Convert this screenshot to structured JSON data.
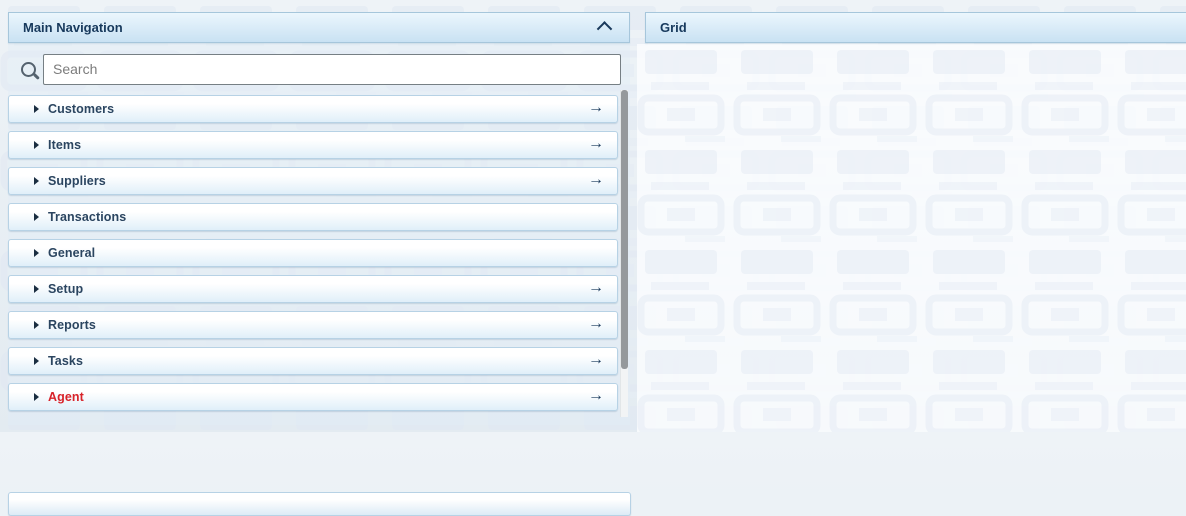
{
  "nav": {
    "title": "Main Navigation",
    "collapse_icon": "chevron-up-icon",
    "search": {
      "placeholder": "Search",
      "value": "",
      "icon": "magnifier-icon"
    },
    "items": [
      {
        "label": "Customers",
        "drill": true
      },
      {
        "label": "Items",
        "drill": true
      },
      {
        "label": "Suppliers",
        "drill": true
      },
      {
        "label": "Transactions",
        "drill": false
      },
      {
        "label": "General",
        "drill": false
      },
      {
        "label": "Setup",
        "drill": true
      },
      {
        "label": "Reports",
        "drill": true
      },
      {
        "label": "Tasks",
        "drill": true
      },
      {
        "label": "Agent",
        "drill": true,
        "text_color": "#d8232a"
      }
    ],
    "scrollbar_visible": true
  },
  "grid": {
    "title": "Grid",
    "content": ""
  },
  "glyphs": {
    "drill_arrow": "→",
    "expand_triangle": "▶"
  },
  "colors": {
    "header_text": "#17395c",
    "item_text": "#2b4560",
    "agent_text": "#d8232a",
    "item_border": "#b7d2e5",
    "header_gradient_top": "#ebf6fd",
    "header_gradient_bottom": "#c9e2f3",
    "item_gradient_top": "#ffffff",
    "item_gradient_bottom": "#e0eff9",
    "scrollbar_thumb": "#95999c",
    "page_background": "#e8eef3"
  }
}
